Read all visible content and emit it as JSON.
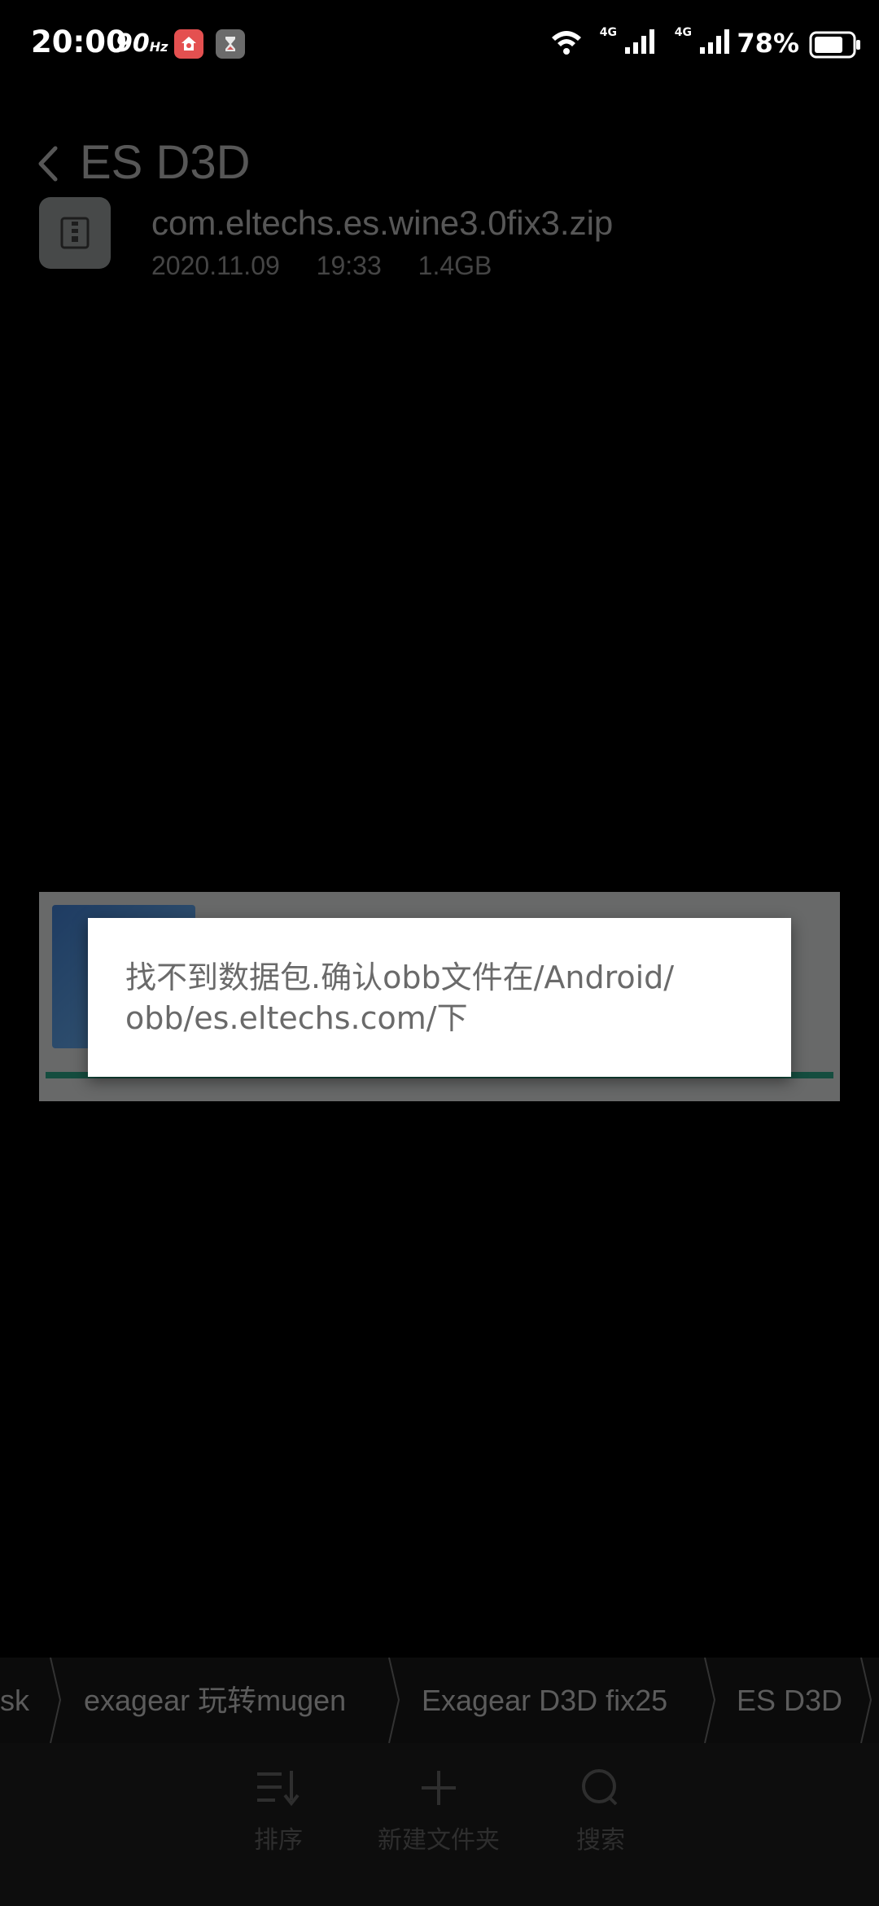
{
  "status_bar": {
    "time": "20:00",
    "refresh_rate": "90",
    "refresh_unit": "Hz",
    "network_1": "4G",
    "network_2": "4G",
    "battery": "78%"
  },
  "header": {
    "title": "ES D3D"
  },
  "files": [
    {
      "name": "com.eltechs.es.wine3.0fix3.zip",
      "date": "2020.11.09",
      "time": "19:33",
      "size": "1.4GB"
    }
  ],
  "dialog": {
    "message": "找不到数据包.确认obb文件在/Android/\nobb/es.eltechs.com/下"
  },
  "breadcrumb": {
    "items": [
      "sk",
      "exagear 玩转mugen",
      "Exagear D3D fix25",
      "ES D3D"
    ]
  },
  "toolbar": {
    "sort_label": "排序",
    "new_folder_label": "新建文件夹",
    "search_label": "搜索"
  },
  "colors": {
    "dialog_background": "#ffffff",
    "dialog_text": "#6a6a6a",
    "progress_accent": "#2a9a7e"
  }
}
